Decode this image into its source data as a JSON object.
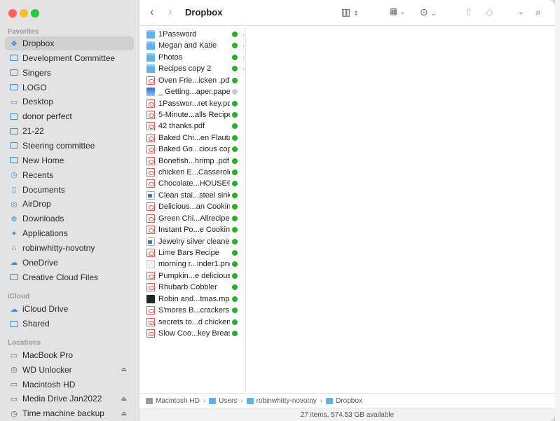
{
  "window": {
    "title": "Dropbox"
  },
  "sidebar": {
    "favorites_label": "Favorites",
    "favorites": [
      {
        "label": "Dropbox",
        "icon": "dropbox-icon",
        "selected": true
      },
      {
        "label": "Development Committee",
        "icon": "folder-icon"
      },
      {
        "label": "Singers",
        "icon": "folder-icon"
      },
      {
        "label": "LOGO",
        "icon": "folder-icon"
      },
      {
        "label": "Desktop",
        "icon": "desktop-icon"
      },
      {
        "label": "donor perfect",
        "icon": "folder-icon"
      },
      {
        "label": "21-22",
        "icon": "folder-icon"
      },
      {
        "label": "Steering committee",
        "icon": "folder-icon"
      },
      {
        "label": "New Home",
        "icon": "folder-icon"
      },
      {
        "label": "Recents",
        "icon": "clock-icon"
      },
      {
        "label": "Documents",
        "icon": "document-icon"
      },
      {
        "label": "AirDrop",
        "icon": "airdrop-icon"
      },
      {
        "label": "Downloads",
        "icon": "download-icon"
      },
      {
        "label": "Applications",
        "icon": "applications-icon"
      },
      {
        "label": "robinwhitty-novotny",
        "icon": "home-icon"
      },
      {
        "label": "OneDrive",
        "icon": "cloud-icon"
      },
      {
        "label": "Creative Cloud Files",
        "icon": "folder-icon"
      }
    ],
    "icloud_label": "iCloud",
    "icloud": [
      {
        "label": "iCloud Drive",
        "icon": "icloud-icon"
      },
      {
        "label": "Shared",
        "icon": "shared-folder-icon"
      }
    ],
    "locations_label": "Locations",
    "locations": [
      {
        "label": "MacBook Pro",
        "icon": "laptop-icon",
        "eject": false
      },
      {
        "label": "WD Unlocker",
        "icon": "disc-icon",
        "eject": true
      },
      {
        "label": "Macintosh HD",
        "icon": "drive-icon",
        "eject": false
      },
      {
        "label": "Media Drive Jan2022",
        "icon": "drive-icon",
        "eject": true
      },
      {
        "label": "Time machine backup",
        "icon": "time-machine-icon",
        "eject": true
      }
    ]
  },
  "files": [
    {
      "name": "1Password",
      "type": "folder",
      "status": "synced",
      "chevron": true
    },
    {
      "name": "Megan and Katie",
      "type": "folder",
      "status": "synced",
      "chevron": true
    },
    {
      "name": "Photos",
      "type": "folder",
      "status": "synced",
      "chevron": true
    },
    {
      "name": "Recipes copy 2",
      "type": "folder",
      "status": "synced",
      "chevron": true
    },
    {
      "name": " Oven Frie...icken .pdf",
      "type": "pdf",
      "status": "synced"
    },
    {
      "name": "_ Getting...aper.paper",
      "type": "paper",
      "status": "cloud"
    },
    {
      "name": "1Passwor...ret key.pdf",
      "type": "pdf",
      "status": "synced"
    },
    {
      "name": "5-Minute...alls Recipe",
      "type": "pdf",
      "status": "synced"
    },
    {
      "name": "42 thanks.pdf",
      "type": "pdf",
      "status": "synced"
    },
    {
      "name": "Baked Chi...en Flautas",
      "type": "pdf",
      "status": "synced"
    },
    {
      "name": "Baked Go...cious copy",
      "type": "pdf",
      "status": "synced"
    },
    {
      "name": "Bonefish...hrimp .pdf",
      "type": "pdf",
      "status": "synced"
    },
    {
      "name": "chicken E...Casserole",
      "type": "pdf",
      "status": "synced"
    },
    {
      "name": "Chocolate...HOUSE®",
      "type": "pdf",
      "status": "synced"
    },
    {
      "name": "Clean stai...steel sink",
      "type": "doc",
      "status": "synced"
    },
    {
      "name": "Delicious...an Cooking",
      "type": "pdf",
      "status": "synced"
    },
    {
      "name": "Green Chi...Allrecipes",
      "type": "pdf",
      "status": "synced"
    },
    {
      "name": "Instant Po...e Cooking",
      "type": "pdf",
      "status": "synced"
    },
    {
      "name": "Jewelry silver cleaner",
      "type": "doc",
      "status": "synced"
    },
    {
      "name": "Lime Bars Recipe",
      "type": "pdf",
      "status": "synced"
    },
    {
      "name": "morning r...inder1.png",
      "type": "png",
      "status": "synced"
    },
    {
      "name": "Pumpkin...e delicious",
      "type": "pdf",
      "status": "synced"
    },
    {
      "name": "Rhubarb Cobbler",
      "type": "pdf",
      "status": "synced"
    },
    {
      "name": "Robin and...tmas.mp4",
      "type": "mp4",
      "status": "synced"
    },
    {
      "name": "S'mores B...crackers",
      "type": "pdf",
      "status": "synced"
    },
    {
      "name": "secrets to...d chicken",
      "type": "pdf",
      "status": "synced"
    },
    {
      "name": "Slow Coo...key Breast",
      "type": "pdf",
      "status": "synced"
    }
  ],
  "pathbar": [
    "Macintosh HD",
    "Users",
    "robinwhitty-novotny",
    "Dropbox"
  ],
  "status": "27 items, 574.53 GB available"
}
